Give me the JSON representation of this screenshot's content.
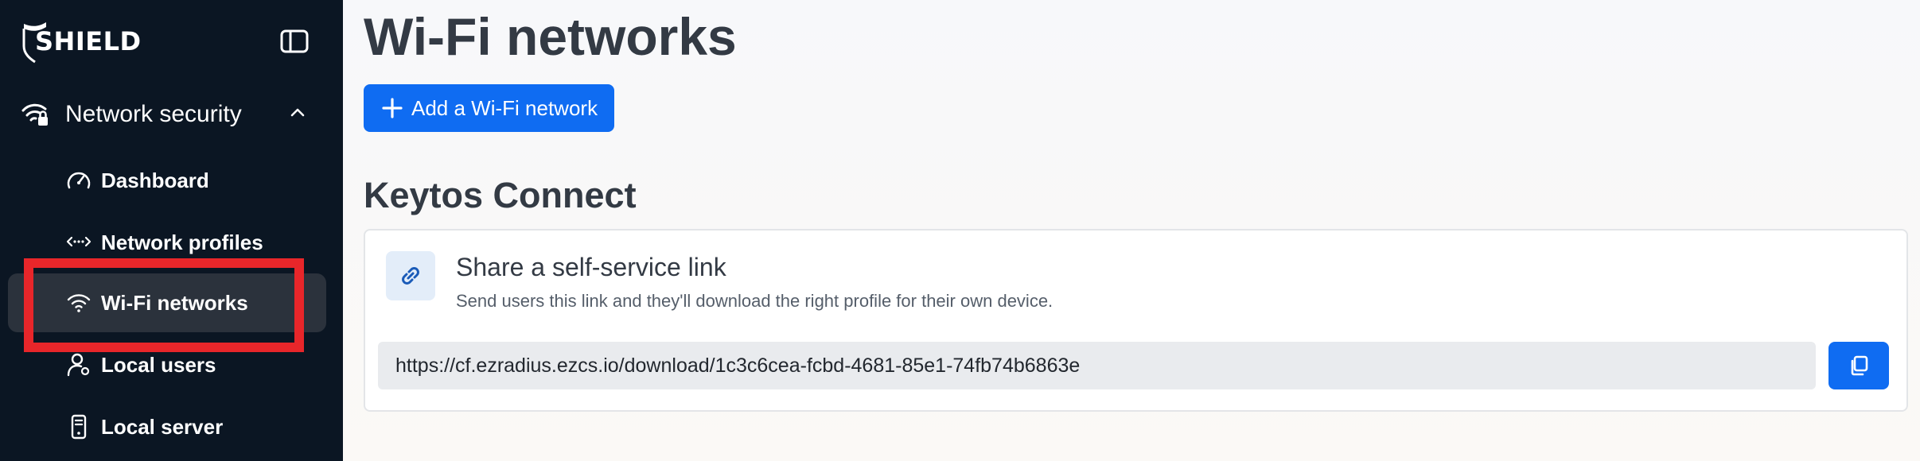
{
  "brand": {
    "name": "SHIELD"
  },
  "sidebar": {
    "section": {
      "label": "Network security",
      "expanded": true
    },
    "items": [
      {
        "label": "Dashboard",
        "icon": "gauge-icon",
        "active": false
      },
      {
        "label": "Network profiles",
        "icon": "network-profiles-icon",
        "active": false
      },
      {
        "label": "Wi-Fi networks",
        "icon": "wifi-icon",
        "active": true
      },
      {
        "label": "Local users",
        "icon": "user-icon",
        "active": false
      },
      {
        "label": "Local server",
        "icon": "server-icon",
        "active": false
      }
    ]
  },
  "main": {
    "title": "Wi-Fi networks",
    "add_button": "Add a Wi-Fi network",
    "connect": {
      "heading": "Keytos Connect",
      "card_title": "Share a self-service link",
      "card_desc": "Send users this link and they'll download the right profile for their own device.",
      "link": "https://cf.ezradius.ezcs.io/download/1c3c6cea-fcbd-4681-85e1-74fb74b6863e"
    }
  },
  "colors": {
    "sidebar_bg": "#0b1623",
    "active_item_bg": "#2b323c",
    "accent": "#0f6cf2",
    "highlight": "#e8262a"
  }
}
